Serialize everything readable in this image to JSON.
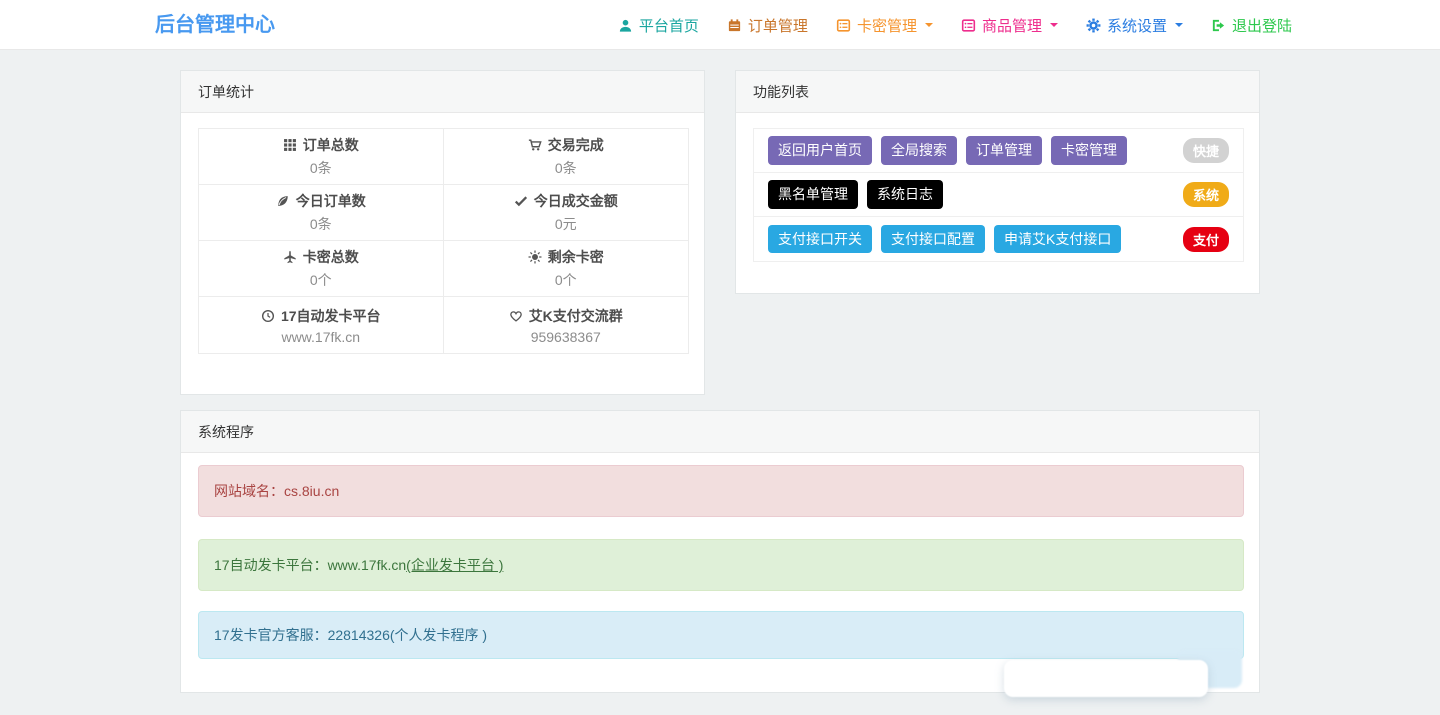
{
  "navbar": {
    "brand": "后台管理中心",
    "brand_color": "#4899f0",
    "items": [
      {
        "label": "平台首页",
        "icon": "user-icon",
        "color": "#1ba6a0",
        "caret": false
      },
      {
        "label": "订单管理",
        "icon": "calendar-icon",
        "color": "#c9762b",
        "caret": false
      },
      {
        "label": "卡密管理",
        "icon": "list-icon",
        "color": "#f5942e",
        "caret": true
      },
      {
        "label": "商品管理",
        "icon": "list-icon",
        "color": "#ee2d8d",
        "caret": true
      },
      {
        "label": "系统设置",
        "icon": "gear-icon",
        "color": "#2b7de1",
        "caret": true
      },
      {
        "label": "退出登陆",
        "icon": "logout-icon",
        "color": "#2dc84d",
        "caret": false
      }
    ]
  },
  "order_stats": {
    "title": "订单统计",
    "cells": [
      {
        "icon": "grid-icon",
        "label": "订单总数",
        "value": "0条"
      },
      {
        "icon": "cart-icon",
        "label": "交易完成",
        "value": "0条"
      },
      {
        "icon": "leaf-icon",
        "label": "今日订单数",
        "value": "0条"
      },
      {
        "icon": "check-icon",
        "label": "今日成交金额",
        "value": "0元"
      },
      {
        "icon": "plane-icon",
        "label": "卡密总数",
        "value": "0个"
      },
      {
        "icon": "sun-icon",
        "label": "剩余卡密",
        "value": "0个"
      },
      {
        "icon": "clock-icon",
        "label": "17自动发卡平台",
        "value": "www.17fk.cn"
      },
      {
        "icon": "heart-icon",
        "label": "艾K支付交流群",
        "value": "959638367"
      }
    ]
  },
  "function_list": {
    "title": "功能列表",
    "rows": [
      {
        "color": "#7769b5",
        "buttons": [
          "返回用户首页",
          "全局搜索",
          "订单管理",
          "卡密管理"
        ],
        "badge": {
          "label": "快捷",
          "color": "#d2d2d2"
        }
      },
      {
        "color": "#000000",
        "buttons": [
          "黑名单管理",
          "系统日志"
        ],
        "badge": {
          "label": "系统",
          "color": "#f0ab18"
        }
      },
      {
        "color": "#29a8e2",
        "buttons": [
          "支付接口开关",
          "支付接口配置",
          "申请艾K支付接口"
        ],
        "badge": {
          "label": "支付",
          "color": "#e60012"
        }
      }
    ]
  },
  "system_program": {
    "title": "系统程序",
    "alerts": [
      {
        "type": "danger",
        "text": "网站域名：cs.8iu.cn",
        "link": "",
        "bg": "#f2dede",
        "border_color": "#ebccd1",
        "color": "#a94442"
      },
      {
        "type": "success",
        "text": "17自动发卡平台：www.17fk.cn ",
        "link": "(企业发卡平台 )",
        "bg": "#dff0d8",
        "border_color": "#d6e9c6",
        "color": "#3c763d"
      },
      {
        "type": "info",
        "text": "17发卡官方客服：22814326 ",
        "link": "(个人发卡程序 )",
        "bg": "#d9edf7",
        "border_color": "#bce8f1",
        "color": "#31708f"
      }
    ]
  }
}
